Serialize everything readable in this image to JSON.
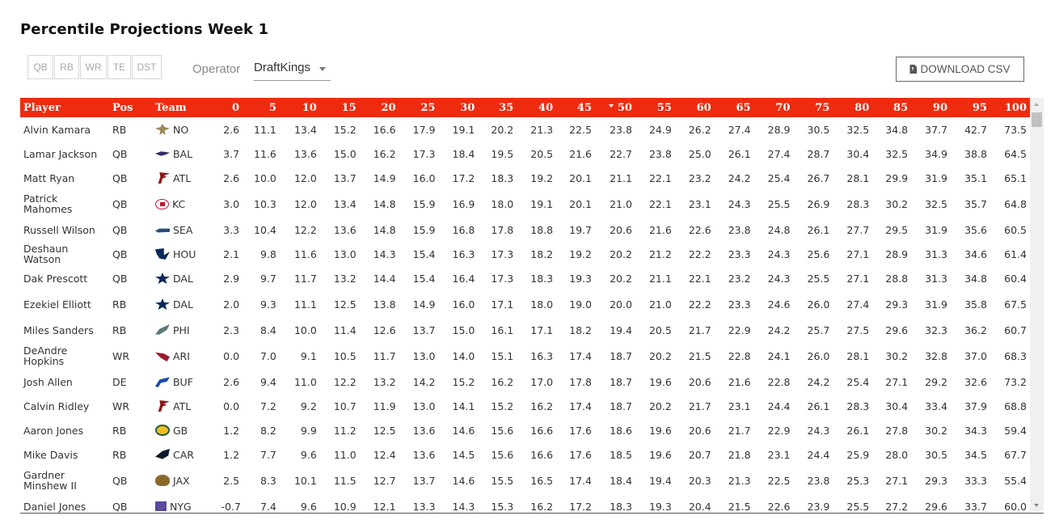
{
  "title": "Percentile Projections Week 1",
  "position_filters": [
    "QB",
    "RB",
    "WR",
    "TE",
    "DST"
  ],
  "operator": {
    "label": "Operator",
    "selected": "DraftKings"
  },
  "download_button": {
    "label": "DOWNLOAD CSV",
    "icon": "file-download-icon"
  },
  "colors": {
    "header_bg": "#ef2b0f",
    "header_text": "#ffffff"
  },
  "table": {
    "columns": [
      "Player",
      "Pos",
      "Team",
      "0",
      "5",
      "10",
      "15",
      "20",
      "25",
      "30",
      "35",
      "40",
      "45",
      "50",
      "55",
      "60",
      "65",
      "70",
      "75",
      "80",
      "85",
      "90",
      "95",
      "100"
    ],
    "sorted_column": "50",
    "rows": [
      {
        "player": "Alvin Kamara",
        "pos": "RB",
        "team": "NO",
        "values": [
          "2.6",
          "11.1",
          "13.4",
          "15.2",
          "16.6",
          "17.9",
          "19.1",
          "20.2",
          "21.3",
          "22.5",
          "23.8",
          "24.9",
          "26.2",
          "27.4",
          "28.9",
          "30.5",
          "32.5",
          "34.8",
          "37.7",
          "42.7",
          "73.5"
        ]
      },
      {
        "player": "Lamar Jackson",
        "pos": "QB",
        "team": "BAL",
        "values": [
          "3.7",
          "11.6",
          "13.6",
          "15.0",
          "16.2",
          "17.3",
          "18.4",
          "19.5",
          "20.5",
          "21.6",
          "22.7",
          "23.8",
          "25.0",
          "26.1",
          "27.4",
          "28.7",
          "30.4",
          "32.5",
          "34.9",
          "38.8",
          "64.5"
        ]
      },
      {
        "player": "Matt Ryan",
        "pos": "QB",
        "team": "ATL",
        "values": [
          "2.6",
          "10.0",
          "12.0",
          "13.7",
          "14.9",
          "16.0",
          "17.2",
          "18.3",
          "19.2",
          "20.1",
          "21.1",
          "22.1",
          "23.2",
          "24.2",
          "25.4",
          "26.7",
          "28.1",
          "29.9",
          "31.9",
          "35.1",
          "65.1"
        ]
      },
      {
        "player": "Patrick Mahomes",
        "pos": "QB",
        "team": "KC",
        "values": [
          "3.0",
          "10.3",
          "12.0",
          "13.4",
          "14.8",
          "15.9",
          "16.9",
          "18.0",
          "19.1",
          "20.1",
          "21.0",
          "22.1",
          "23.1",
          "24.3",
          "25.5",
          "26.9",
          "28.3",
          "30.2",
          "32.5",
          "35.7",
          "64.8"
        ]
      },
      {
        "player": "Russell Wilson",
        "pos": "QB",
        "team": "SEA",
        "values": [
          "3.3",
          "10.4",
          "12.2",
          "13.6",
          "14.8",
          "15.9",
          "16.8",
          "17.8",
          "18.8",
          "19.7",
          "20.6",
          "21.6",
          "22.6",
          "23.8",
          "24.8",
          "26.1",
          "27.7",
          "29.5",
          "31.9",
          "35.6",
          "60.5"
        ]
      },
      {
        "player": "Deshaun Watson",
        "pos": "QB",
        "team": "HOU",
        "values": [
          "2.1",
          "9.8",
          "11.6",
          "13.0",
          "14.3",
          "15.4",
          "16.3",
          "17.3",
          "18.2",
          "19.2",
          "20.2",
          "21.2",
          "22.2",
          "23.3",
          "24.3",
          "25.6",
          "27.1",
          "28.9",
          "31.3",
          "34.6",
          "61.4"
        ]
      },
      {
        "player": "Dak Prescott",
        "pos": "QB",
        "team": "DAL",
        "values": [
          "2.9",
          "9.7",
          "11.7",
          "13.2",
          "14.4",
          "15.4",
          "16.4",
          "17.3",
          "18.3",
          "19.3",
          "20.2",
          "21.1",
          "22.1",
          "23.2",
          "24.3",
          "25.5",
          "27.1",
          "28.8",
          "31.3",
          "34.8",
          "60.4"
        ]
      },
      {
        "player": "Ezekiel Elliott",
        "pos": "RB",
        "team": "DAL",
        "values": [
          "2.0",
          "9.3",
          "11.1",
          "12.5",
          "13.8",
          "14.9",
          "16.0",
          "17.1",
          "18.0",
          "19.0",
          "20.0",
          "21.0",
          "22.2",
          "23.3",
          "24.6",
          "26.0",
          "27.4",
          "29.3",
          "31.9",
          "35.8",
          "67.5"
        ]
      },
      {
        "player": "Miles Sanders",
        "pos": "RB",
        "team": "PHI",
        "values": [
          "2.3",
          "8.4",
          "10.0",
          "11.4",
          "12.6",
          "13.7",
          "15.0",
          "16.1",
          "17.1",
          "18.2",
          "19.4",
          "20.5",
          "21.7",
          "22.9",
          "24.2",
          "25.7",
          "27.5",
          "29.6",
          "32.3",
          "36.2",
          "60.7"
        ]
      },
      {
        "player": "DeAndre Hopkins",
        "pos": "WR",
        "team": "ARI",
        "values": [
          "0.0",
          "7.0",
          "9.1",
          "10.5",
          "11.7",
          "13.0",
          "14.0",
          "15.1",
          "16.3",
          "17.4",
          "18.7",
          "20.2",
          "21.5",
          "22.8",
          "24.1",
          "26.0",
          "28.1",
          "30.2",
          "32.8",
          "37.0",
          "68.3"
        ]
      },
      {
        "player": "Josh Allen",
        "pos": "DE",
        "team": "BUF",
        "values": [
          "2.6",
          "9.4",
          "11.0",
          "12.2",
          "13.2",
          "14.2",
          "15.2",
          "16.2",
          "17.0",
          "17.8",
          "18.7",
          "19.6",
          "20.6",
          "21.6",
          "22.8",
          "24.2",
          "25.4",
          "27.1",
          "29.2",
          "32.6",
          "73.2"
        ]
      },
      {
        "player": "Calvin Ridley",
        "pos": "WR",
        "team": "ATL",
        "values": [
          "0.0",
          "7.2",
          "9.2",
          "10.7",
          "11.9",
          "13.0",
          "14.1",
          "15.2",
          "16.2",
          "17.4",
          "18.7",
          "20.2",
          "21.7",
          "23.1",
          "24.4",
          "26.1",
          "28.3",
          "30.4",
          "33.4",
          "37.9",
          "68.8"
        ]
      },
      {
        "player": "Aaron Jones",
        "pos": "RB",
        "team": "GB",
        "values": [
          "1.2",
          "8.2",
          "9.9",
          "11.2",
          "12.5",
          "13.6",
          "14.6",
          "15.6",
          "16.6",
          "17.6",
          "18.6",
          "19.6",
          "20.6",
          "21.7",
          "22.9",
          "24.3",
          "26.1",
          "27.8",
          "30.2",
          "34.3",
          "59.4"
        ]
      },
      {
        "player": "Mike Davis",
        "pos": "RB",
        "team": "CAR",
        "values": [
          "1.2",
          "7.7",
          "9.6",
          "11.0",
          "12.4",
          "13.6",
          "14.5",
          "15.6",
          "16.6",
          "17.6",
          "18.5",
          "19.6",
          "20.7",
          "21.8",
          "23.1",
          "24.4",
          "25.9",
          "28.0",
          "30.5",
          "34.5",
          "67.7"
        ]
      },
      {
        "player": "Gardner Minshew II",
        "pos": "QB",
        "team": "JAX",
        "values": [
          "2.5",
          "8.3",
          "10.1",
          "11.5",
          "12.7",
          "13.7",
          "14.6",
          "15.5",
          "16.5",
          "17.4",
          "18.4",
          "19.4",
          "20.3",
          "21.3",
          "22.5",
          "23.8",
          "25.3",
          "27.1",
          "29.3",
          "33.3",
          "55.4"
        ]
      },
      {
        "player": "Daniel Jones",
        "pos": "QB",
        "team": "NYG",
        "values": [
          "-0.7",
          "7.4",
          "9.6",
          "10.9",
          "12.1",
          "13.3",
          "14.3",
          "15.3",
          "16.2",
          "17.2",
          "18.3",
          "19.3",
          "20.4",
          "21.5",
          "22.6",
          "23.9",
          "25.5",
          "27.2",
          "29.6",
          "33.7",
          "60.0"
        ]
      }
    ]
  }
}
